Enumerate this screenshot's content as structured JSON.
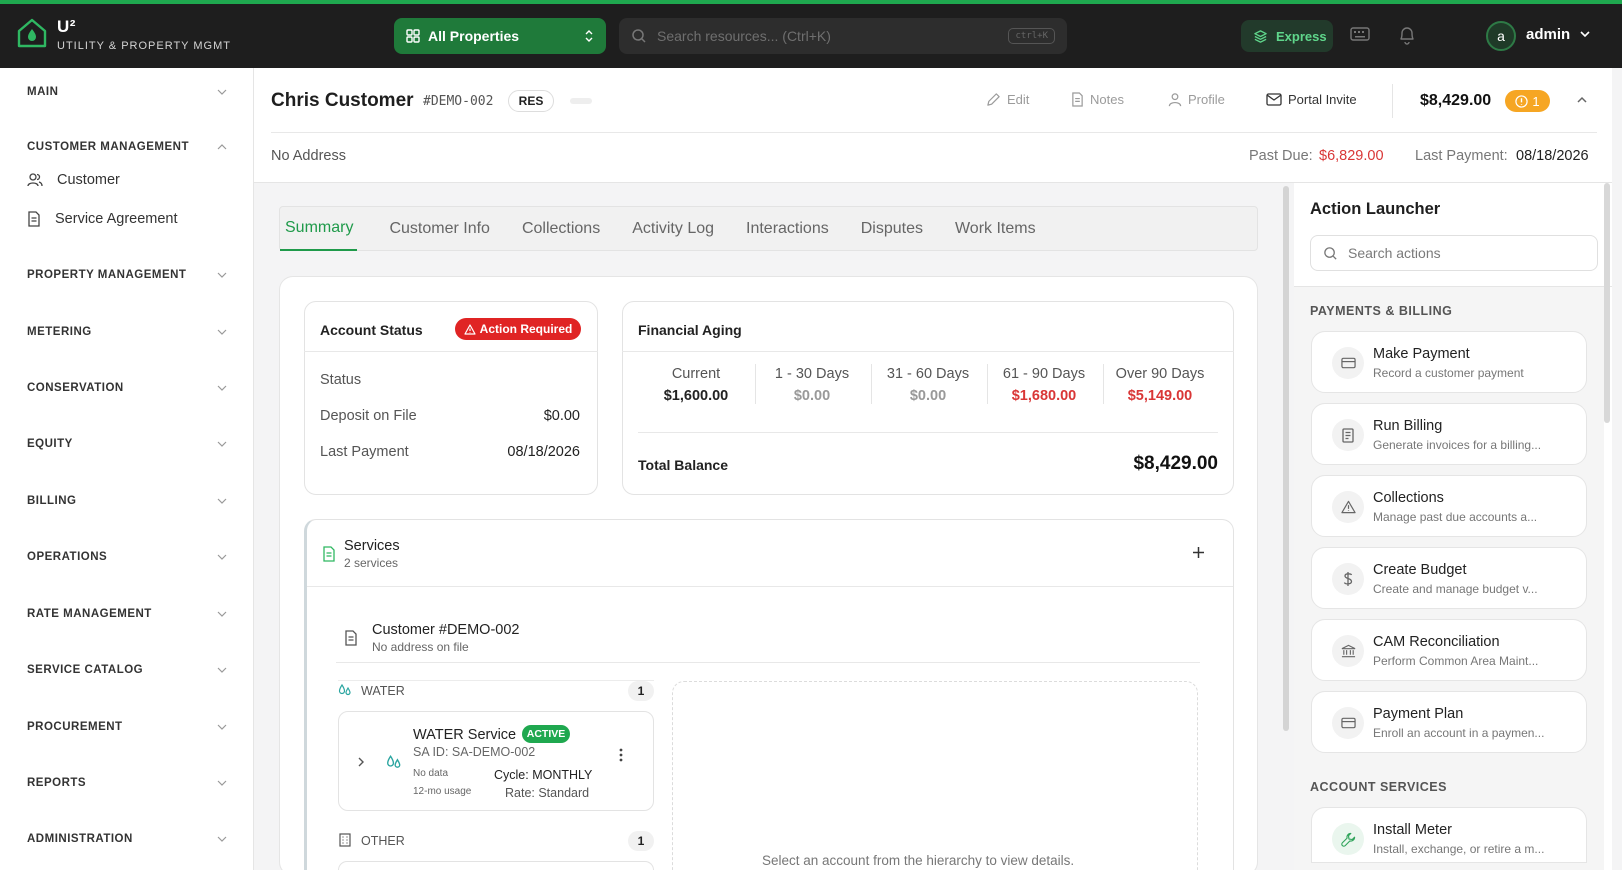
{
  "app": {
    "logo_title": "U²",
    "logo_subtitle": "UTILITY & PROPERTY MGMT",
    "property_selector": "All Properties",
    "search_placeholder": "Search resources... (Ctrl+K)",
    "search_shortcut": "ctrl+K",
    "express_label": "Express",
    "user_initial": "a",
    "user_name": "admin"
  },
  "sidebar": {
    "sections": [
      {
        "label": "MAIN",
        "expanded": false
      },
      {
        "label": "CUSTOMER MANAGEMENT",
        "expanded": true,
        "items": [
          {
            "label": "Customer",
            "icon": "users-icon"
          },
          {
            "label": "Service Agreement",
            "icon": "document-icon"
          }
        ]
      },
      {
        "label": "PROPERTY MANAGEMENT",
        "expanded": false
      },
      {
        "label": "METERING",
        "expanded": false
      },
      {
        "label": "CONSERVATION",
        "expanded": false
      },
      {
        "label": "EQUITY",
        "expanded": false
      },
      {
        "label": "BILLING",
        "expanded": false
      },
      {
        "label": "OPERATIONS",
        "expanded": false
      },
      {
        "label": "RATE MANAGEMENT",
        "expanded": false
      },
      {
        "label": "SERVICE CATALOG",
        "expanded": false
      },
      {
        "label": "PROCUREMENT",
        "expanded": false
      },
      {
        "label": "REPORTS",
        "expanded": false
      },
      {
        "label": "ADMINISTRATION",
        "expanded": false
      }
    ]
  },
  "customer": {
    "name": "Chris Customer",
    "id": "#DEMO-002",
    "type_badge": "RES",
    "address": "No Address",
    "total_balance": "$8,429.00",
    "alert_count": "1",
    "past_due_label": "Past Due:",
    "past_due_value": "$6,829.00",
    "last_payment_label": "Last Payment:",
    "last_payment_value": "08/18/2026",
    "actions": [
      "Edit",
      "Notes",
      "Profile",
      "Portal Invite"
    ]
  },
  "tabs": [
    "Summary",
    "Customer Info",
    "Collections",
    "Activity Log",
    "Interactions",
    "Disputes",
    "Work Items"
  ],
  "account_status": {
    "title": "Account Status",
    "badge": "Action Required",
    "rows": [
      {
        "label": "Status",
        "value": ""
      },
      {
        "label": "Deposit on File",
        "value": "$0.00"
      },
      {
        "label": "Last Payment",
        "value": "08/18/2026"
      }
    ]
  },
  "financial_aging": {
    "title": "Financial Aging",
    "buckets": [
      {
        "label": "Current",
        "value": "$1,600.00",
        "tone": "dark"
      },
      {
        "label": "1 - 30 Days",
        "value": "$0.00",
        "tone": "muted"
      },
      {
        "label": "31 - 60 Days",
        "value": "$0.00",
        "tone": "muted"
      },
      {
        "label": "61 - 90 Days",
        "value": "$1,680.00",
        "tone": "red"
      },
      {
        "label": "Over 90 Days",
        "value": "$5,149.00",
        "tone": "red"
      }
    ],
    "total_label": "Total Balance",
    "total_value": "$8,429.00"
  },
  "services": {
    "title": "Services",
    "count": "2 services",
    "customer_node": {
      "title": "Customer #DEMO-002",
      "subtitle": "No address on file"
    },
    "groups": [
      {
        "label": "WATER",
        "count": "1"
      },
      {
        "label": "OTHER",
        "count": "1"
      }
    ],
    "water_service": {
      "title": "WATER Service",
      "status": "ACTIVE",
      "sa_id": "SA ID: SA-DEMO-002",
      "no_data": "No data",
      "usage": "12-mo usage",
      "cycle": "Cycle: MONTHLY",
      "rate": "Rate: Standard"
    },
    "detail_placeholder": "Select an account from the hierarchy to view details."
  },
  "launcher": {
    "title": "Action Launcher",
    "search_placeholder": "Search actions",
    "sections": [
      {
        "label": "PAYMENTS & BILLING",
        "actions": [
          {
            "title": "Make Payment",
            "desc": "Record a customer payment",
            "icon": "card-icon"
          },
          {
            "title": "Run Billing",
            "desc": "Generate invoices for a billing...",
            "icon": "invoice-icon"
          },
          {
            "title": "Collections",
            "desc": "Manage past due accounts a...",
            "icon": "warning-icon"
          },
          {
            "title": "Create Budget",
            "desc": "Create and manage budget v...",
            "icon": "dollar-icon"
          },
          {
            "title": "CAM Reconciliation",
            "desc": "Perform Common Area Maint...",
            "icon": "bank-icon"
          },
          {
            "title": "Payment Plan",
            "desc": "Enroll an account in a paymen...",
            "icon": "card-icon"
          }
        ]
      },
      {
        "label": "ACCOUNT SERVICES",
        "actions": [
          {
            "title": "Install Meter",
            "desc": "Install, exchange, or retire a m...",
            "icon": "wrench-icon"
          }
        ]
      }
    ]
  },
  "colors": {
    "brand_green": "#1fa84f",
    "danger_red": "#d93636",
    "warning_orange": "#f6a623",
    "topbar_bg": "#1e1e1e"
  }
}
